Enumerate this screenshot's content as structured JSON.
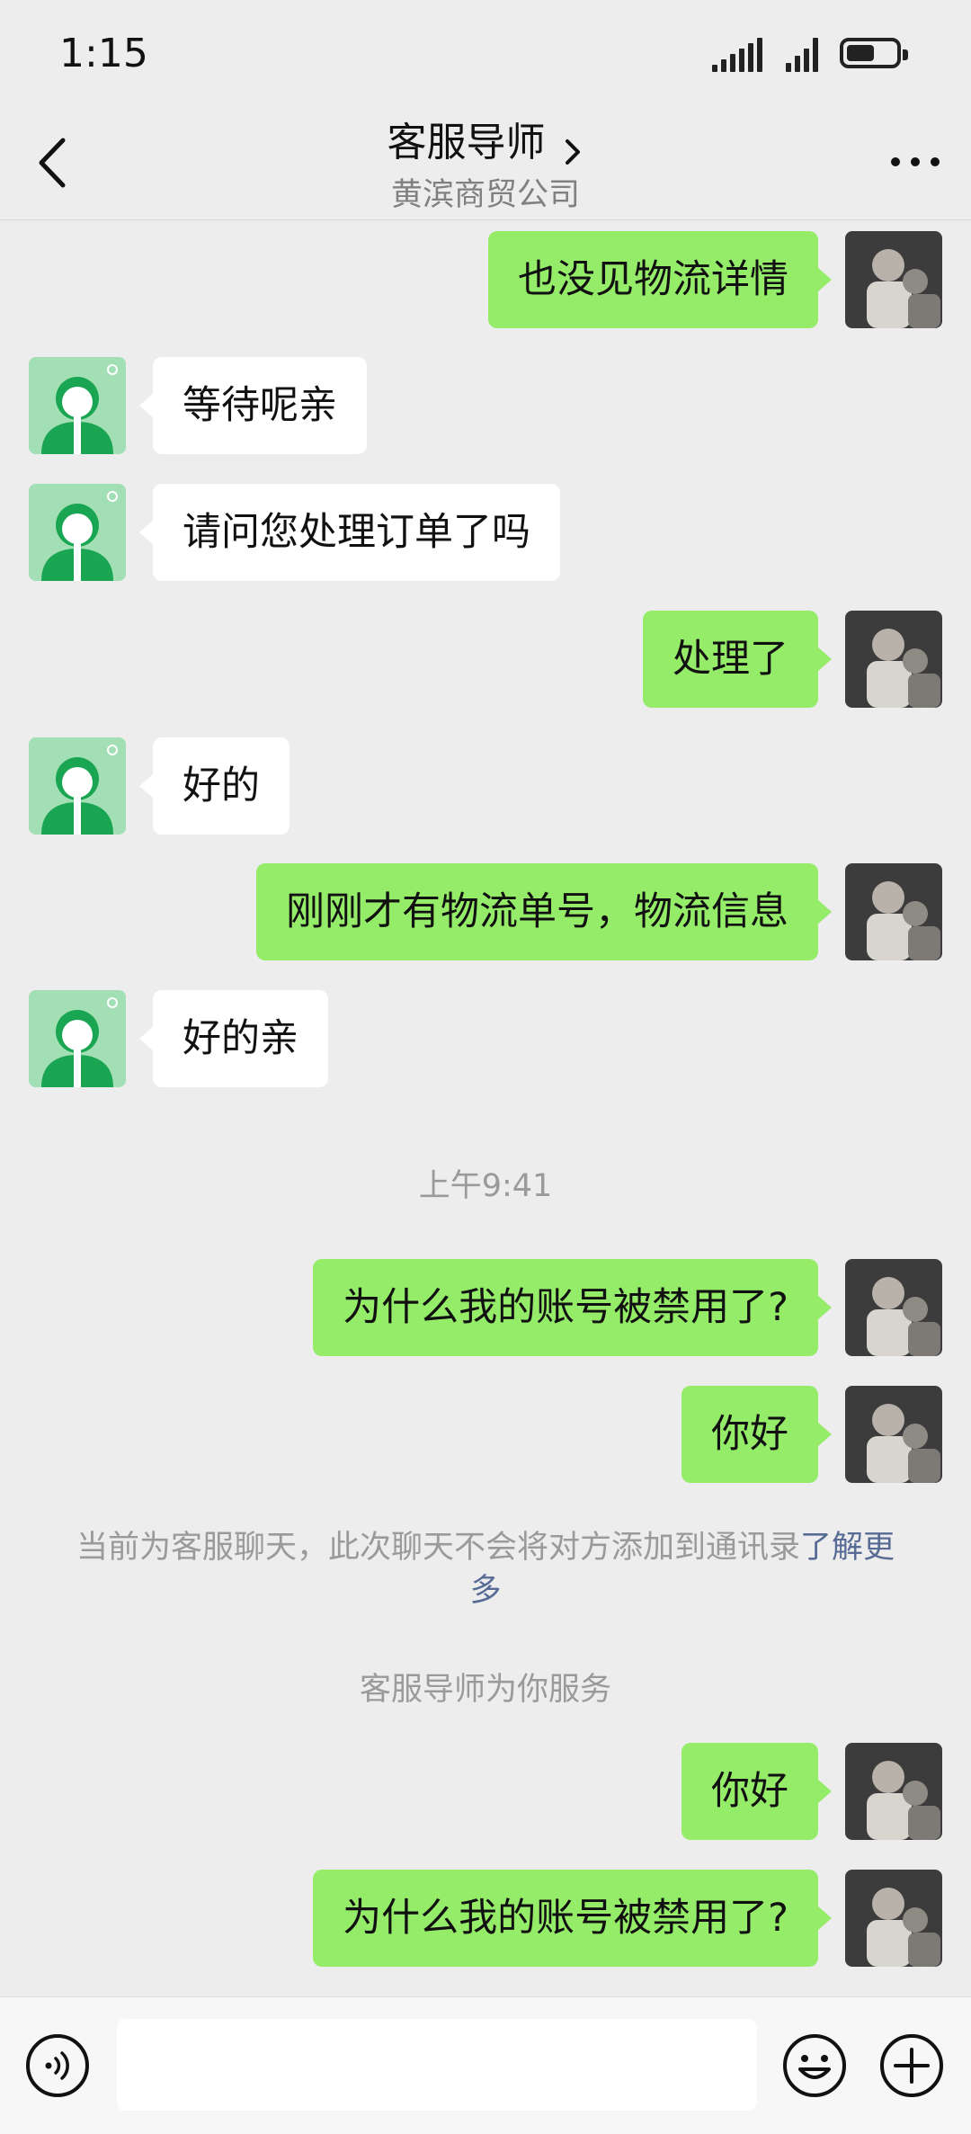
{
  "status": {
    "time": "1:15"
  },
  "header": {
    "title": "客服导师",
    "subtitle": "黄滨商贸公司"
  },
  "messages": [
    {
      "from": "me",
      "text": "也没见物流详情"
    },
    {
      "from": "agent",
      "text": "等待呢亲"
    },
    {
      "from": "agent",
      "text": "请问您处理订单了吗"
    },
    {
      "from": "me",
      "text": "处理了"
    },
    {
      "from": "agent",
      "text": "好的"
    },
    {
      "from": "me",
      "text": "刚刚才有物流单号，物流信息"
    },
    {
      "from": "agent",
      "text": "好的亲"
    },
    {
      "from": "me",
      "text": "为什么我的账号被禁用了?"
    },
    {
      "from": "me",
      "text": "你好"
    },
    {
      "from": "me",
      "text": "你好"
    },
    {
      "from": "me",
      "text": "为什么我的账号被禁用了?"
    }
  ],
  "system": {
    "timestamp": "上午9:41",
    "notice_text": "当前为客服聊天，此次聊天不会将对方添加到通讯录",
    "notice_link": "了解更多",
    "service_text": "客服导师为你服务"
  },
  "input": {
    "value": ""
  },
  "icons": {
    "back": "chevron-left-icon",
    "title_chevron": "chevron-right-icon",
    "more": "more-dots-icon",
    "voice": "voice-icon",
    "emoji": "emoji-icon",
    "plus": "plus-icon"
  },
  "colors": {
    "outgoing_bubble": "#95ec69",
    "incoming_bubble": "#ffffff",
    "background": "#ededed",
    "link": "#576b95"
  }
}
